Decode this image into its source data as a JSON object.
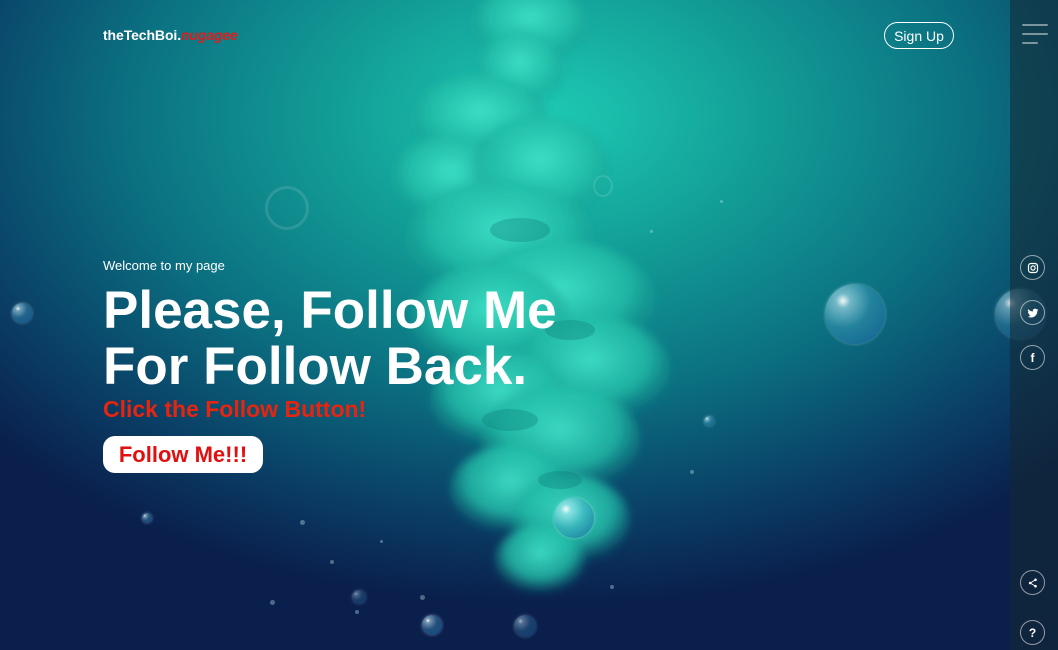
{
  "header": {
    "logo_main": "theTechBoi.",
    "logo_accent": "nugagee",
    "signup_label": "Sign Up"
  },
  "hero": {
    "welcome": "Welcome to my page",
    "headline_line1": "Please, Follow Me",
    "headline_line2": "For Follow Back.",
    "subline": "Click the Follow Button!",
    "follow_label": "Follow Me!!!"
  },
  "sidebar": {
    "menu_icon": "hamburger-menu-icon",
    "social": [
      {
        "name": "instagram-icon"
      },
      {
        "name": "twitter-icon"
      },
      {
        "name": "facebook-icon",
        "glyph": "f"
      }
    ],
    "share_icon": "share-icon",
    "help_glyph": "?"
  },
  "colors": {
    "accent_red": "#e21b1b",
    "subline_red": "#e7240f",
    "teal": "#1ec9b3",
    "deep_blue": "#0a1f4c"
  }
}
